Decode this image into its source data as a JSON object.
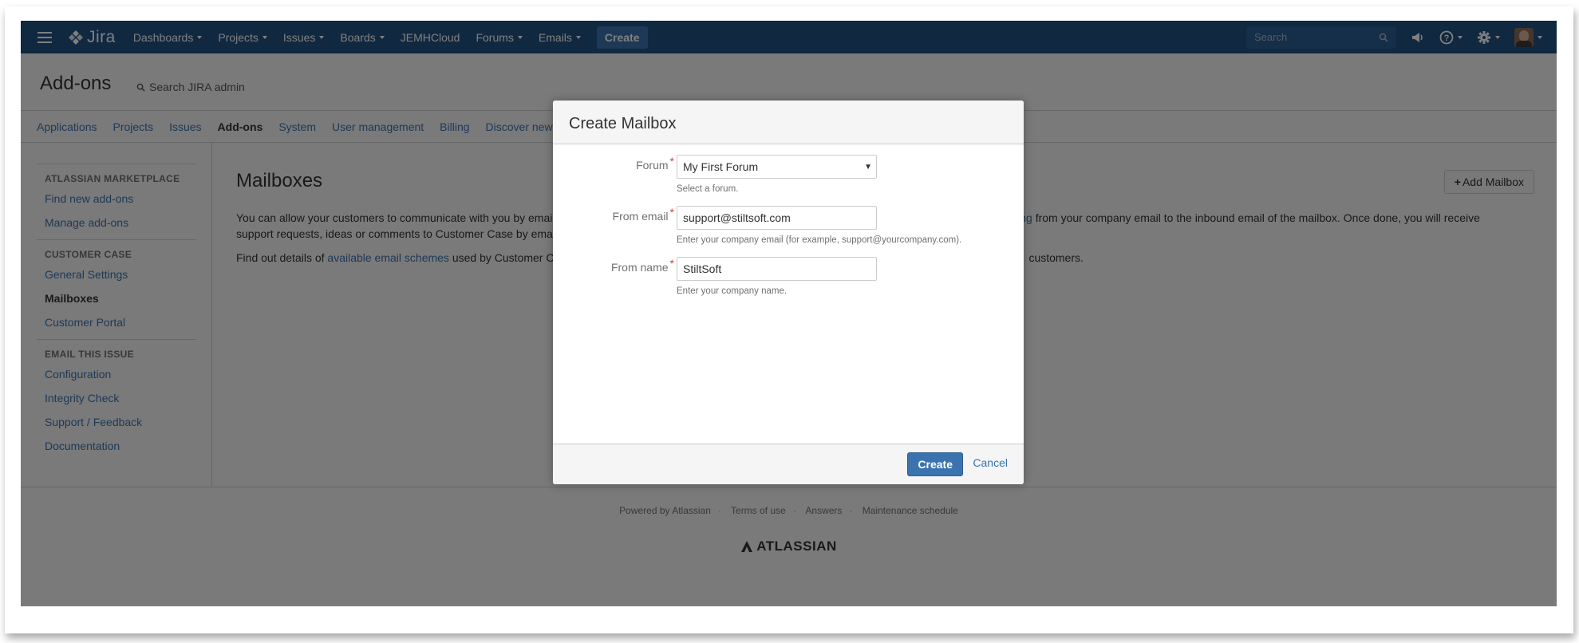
{
  "header": {
    "product": "Jira",
    "nav": [
      {
        "label": "Dashboards",
        "dropdown": true
      },
      {
        "label": "Projects",
        "dropdown": true
      },
      {
        "label": "Issues",
        "dropdown": true
      },
      {
        "label": "Boards",
        "dropdown": true
      },
      {
        "label": "JEMHCloud",
        "dropdown": false
      },
      {
        "label": "Forums",
        "dropdown": true
      },
      {
        "label": "Emails",
        "dropdown": true
      }
    ],
    "create_label": "Create",
    "search_placeholder": "Search",
    "bg_color": "#205081"
  },
  "admin": {
    "title": "Add-ons",
    "search_label": "Search JIRA admin",
    "tabs": [
      "Applications",
      "Projects",
      "Issues",
      "Add-ons",
      "System",
      "User management",
      "Billing",
      "Discover new"
    ],
    "active_tab": "Add-ons"
  },
  "sidebar": {
    "sections": [
      {
        "heading": "ATLASSIAN MARKETPLACE",
        "items": [
          "Find new add-ons",
          "Manage add-ons"
        ]
      },
      {
        "heading": "CUSTOMER CASE",
        "items": [
          "General Settings",
          "Mailboxes",
          "Customer Portal"
        ]
      },
      {
        "heading": "EMAIL THIS ISSUE",
        "items": [
          "Configuration",
          "Integrity Check",
          "Support / Feedback",
          "Documentation"
        ]
      }
    ],
    "active_item": "Mailboxes"
  },
  "main": {
    "title": "Mailboxes",
    "add_button": "Add Mailbox",
    "para1_line1_start": "You can allow your customers to communicate with you by emai",
    "para1_link": "orwarding",
    "para1_line1_end": " from your company email to the inbound email of the mailbox. Once done, you will receive",
    "para1_line2": "support requests, ideas or comments to Customer Case by ema",
    "para2_start": "Find out details of ",
    "para2_link": "available email schemes",
    "para2_mid": " used by Customer C",
    "para2_end": "customers."
  },
  "footer": {
    "links": [
      "Powered by Atlassian",
      "Terms of use",
      "Answers",
      "Maintenance schedule"
    ],
    "logo_text": "ATLASSIAN"
  },
  "dialog": {
    "title": "Create Mailbox",
    "forum": {
      "label": "Forum",
      "value": "My First Forum",
      "hint": "Select a forum."
    },
    "from_email": {
      "label": "From email",
      "value": "support@stiltsoft.com",
      "hint": "Enter your company email (for example, support@yourcompany.com)."
    },
    "from_name": {
      "label": "From name",
      "value": "StiltSoft",
      "hint": "Enter your company name."
    },
    "create_label": "Create",
    "cancel_label": "Cancel"
  }
}
